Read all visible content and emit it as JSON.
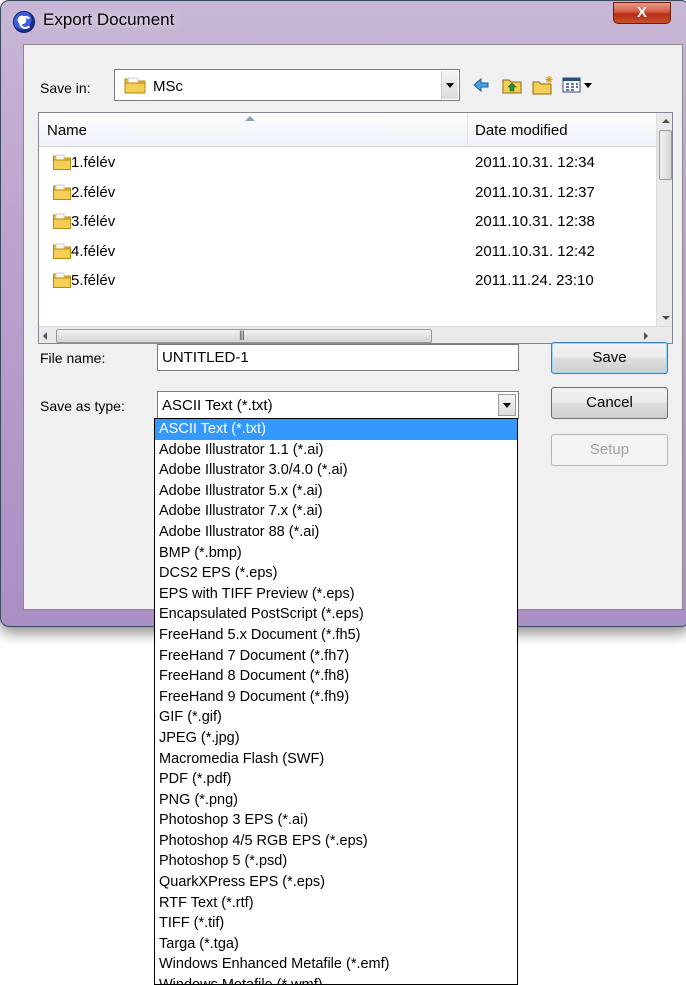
{
  "window": {
    "title": "Export Document",
    "close_label": "X"
  },
  "toolbar": {
    "save_in_label": "Save in:",
    "save_in_value": "MSc"
  },
  "file_list": {
    "columns": {
      "name": "Name",
      "date": "Date modified"
    },
    "rows": [
      {
        "name": "1.félév",
        "date": "2011.10.31. 12:34"
      },
      {
        "name": "2.félév",
        "date": "2011.10.31. 12:37"
      },
      {
        "name": "3.félév",
        "date": "2011.10.31. 12:38"
      },
      {
        "name": "4.félév",
        "date": "2011.10.31. 12:42"
      },
      {
        "name": "5.félév",
        "date": "2011.11.24. 23:10"
      }
    ]
  },
  "form": {
    "file_name_label": "File name:",
    "file_name_value": "UNTITLED-1",
    "save_as_type_label": "Save as type:",
    "save_as_type_value": "ASCII Text (*.txt)"
  },
  "buttons": {
    "save": "Save",
    "cancel": "Cancel",
    "setup": "Setup"
  },
  "type_options": [
    "ASCII Text (*.txt)",
    "Adobe Illustrator 1.1 (*.ai)",
    "Adobe Illustrator 3.0/4.0 (*.ai)",
    "Adobe Illustrator 5.x (*.ai)",
    "Adobe Illustrator 7.x (*.ai)",
    "Adobe Illustrator 88 (*.ai)",
    "BMP (*.bmp)",
    "DCS2 EPS (*.eps)",
    "EPS with TIFF Preview (*.eps)",
    "Encapsulated PostScript (*.eps)",
    "FreeHand 5.x Document (*.fh5)",
    "FreeHand 7 Document (*.fh7)",
    "FreeHand 8 Document (*.fh8)",
    "FreeHand 9 Document (*.fh9)",
    "GIF (*.gif)",
    "JPEG (*.jpg)",
    "Macromedia Flash (SWF)",
    "PDF (*.pdf)",
    "PNG (*.png)",
    "Photoshop 3 EPS (*.ai)",
    "Photoshop 4/5 RGB EPS (*.eps)",
    "Photoshop 5 (*.psd)",
    "QuarkXPress EPS (*.eps)",
    "RTF Text (*.rtf)",
    "TIFF (*.tif)",
    "Targa (*.tga)",
    "Windows Enhanced Metafile (*.emf)",
    "Windows Metafile (*.wmf)"
  ],
  "selected_type_index": 0,
  "colors": {
    "selection": "#3399ff",
    "title_bar": "#bca4cf",
    "close_button": "#c9512e"
  }
}
